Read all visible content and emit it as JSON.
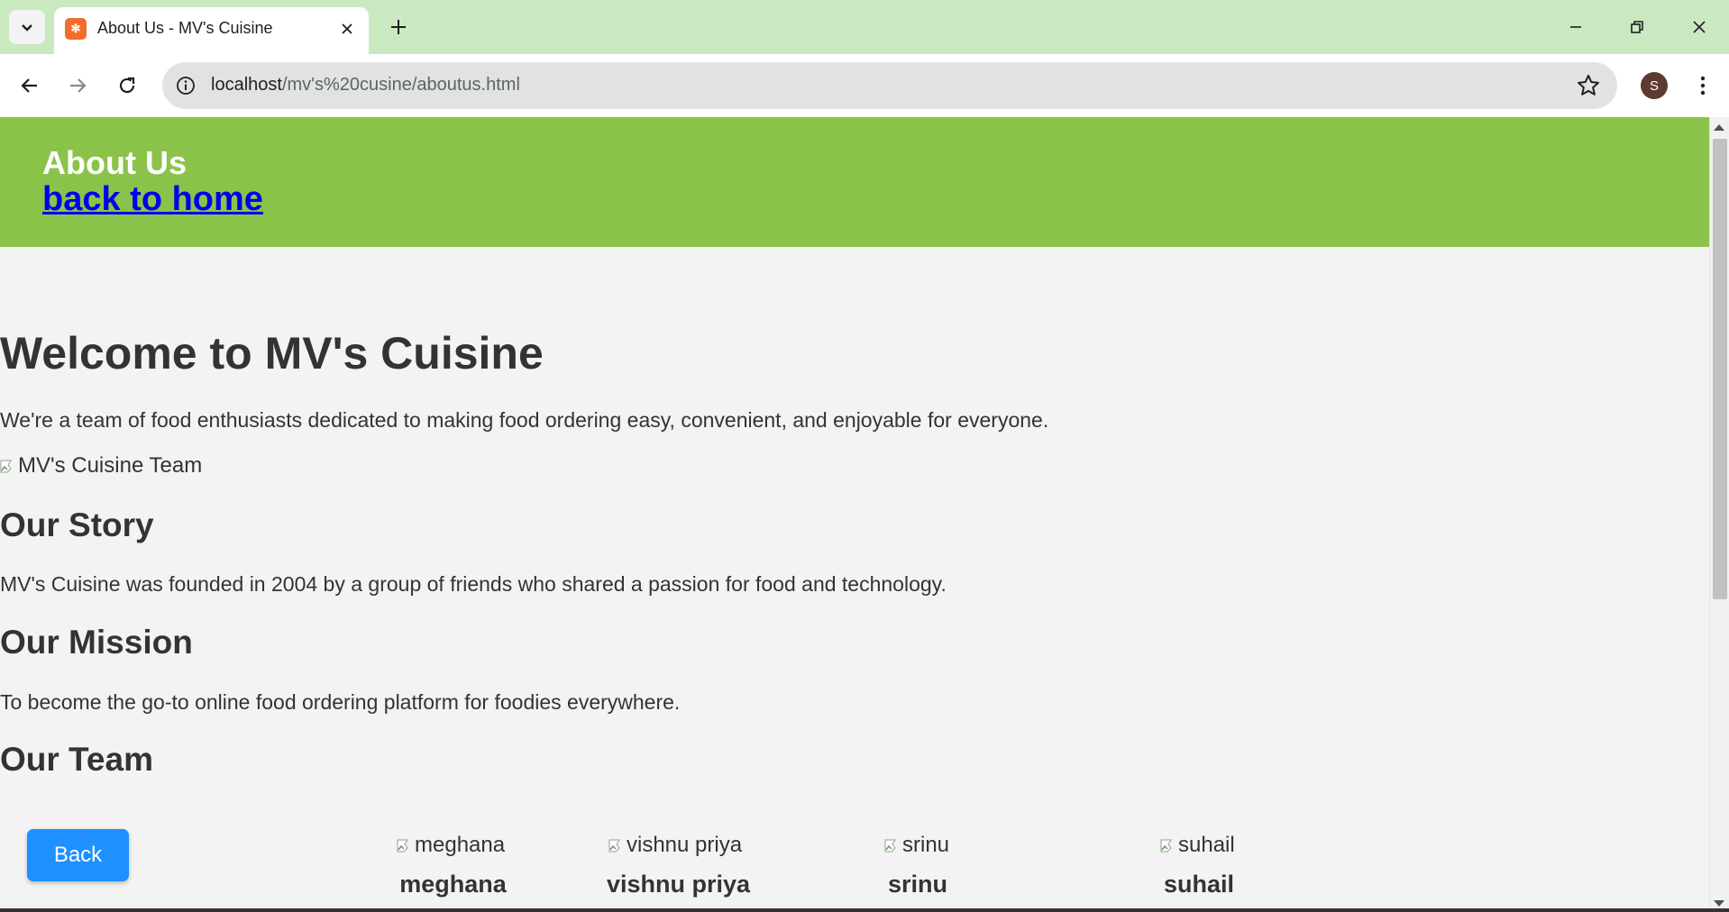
{
  "browser": {
    "tab_title": "About Us - MV's Cuisine",
    "url_host": "localhost",
    "url_path": "/mv's%20cusine/aboutus.html",
    "profile_initial": "S"
  },
  "header": {
    "title": "About Us",
    "home_link": "back to home"
  },
  "main": {
    "welcome_heading": "Welcome to MV's Cuisine",
    "intro": "We're a team of food enthusiasts dedicated to making food ordering easy, convenient, and enjoyable for everyone.",
    "team_image_alt": "MV's Cuisine Team",
    "story_heading": "Our Story",
    "story_text": "MV's Cuisine was founded in 2004 by a group of friends who shared a passion for food and technology.",
    "mission_heading": "Our Mission",
    "mission_text": "To become the go-to online food ordering platform for foodies everywhere.",
    "team_heading": "Our Team"
  },
  "team": [
    {
      "alt": "meghana",
      "name": "meghana"
    },
    {
      "alt": "vishnu priya",
      "name": "vishnu priya"
    },
    {
      "alt": "srinu",
      "name": "srinu"
    },
    {
      "alt": "suhail",
      "name": "suhail"
    }
  ],
  "back_button": "Back",
  "colors": {
    "tabstrip": "#cbe9c1",
    "hero": "#8bc34a",
    "link": "#0000ee",
    "button": "#1e90ff",
    "text": "#333333",
    "page_bg": "#f3f3f3"
  }
}
